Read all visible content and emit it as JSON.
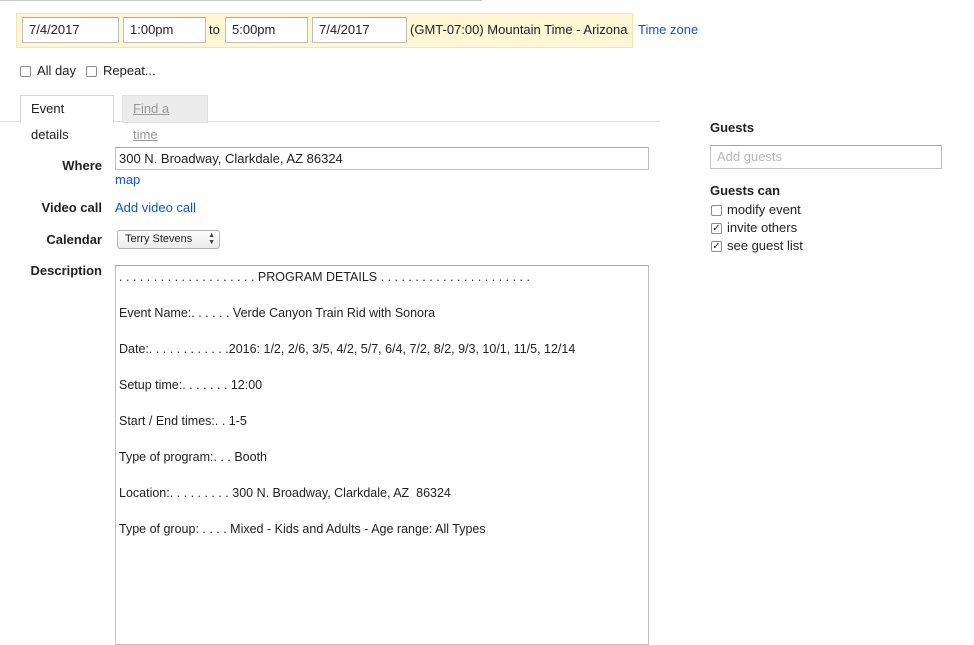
{
  "datetime": {
    "start_date": "7/4/2017",
    "start_time": "1:00pm",
    "to_label": "to",
    "end_time": "5:00pm",
    "end_date": "7/4/2017",
    "timezone": "(GMT-07:00) Mountain Time - Arizona",
    "timezone_link": "Time zone"
  },
  "options": {
    "all_day": {
      "label": "All day",
      "checked": false
    },
    "repeat": {
      "label": "Repeat...",
      "checked": false
    }
  },
  "tabs": [
    {
      "label": "Event details",
      "active": true
    },
    {
      "label": "Find a time",
      "active": false
    }
  ],
  "details": {
    "where_label": "Where",
    "where_value": "300 N. Broadway, Clarkdale, AZ 86324",
    "map_link": "map",
    "video_label": "Video call",
    "video_link": "Add video call",
    "calendar_label": "Calendar",
    "calendar_value": "Terry Stevens",
    "description_label": "Description",
    "description_lines": [
      ". . . . . . . . . . . . . . . . . . . . PROGRAM DETAILS . . . . . . . . . . . . . . . . . . . . . .",
      "",
      "Event Name:. . . . . . Verde Canyon Train Rid with Sonora",
      "",
      "Date:. . . . . . . . . . . .2016: 1/2, 2/6, 3/5, 4/2, 5/7, 6/4, 7/2, 8/2, 9/3, 10/1, 11/5, 12/14",
      "",
      "Setup time:. . . . . . . 12:00",
      "",
      "Start / End times:. . 1-5",
      "",
      "Type of program:. . . Booth",
      "",
      "Location:. . . . . . . . . 300 N. Broadway, Clarkdale, AZ  86324",
      "",
      "Type of group: . . . . Mixed - Kids and Adults - Age range: All Types"
    ]
  },
  "guests": {
    "heading": "Guests",
    "placeholder": "Add guests",
    "guests_can_heading": "Guests can",
    "permissions": [
      {
        "label": "modify event",
        "checked": false
      },
      {
        "label": "invite others",
        "checked": true
      },
      {
        "label": "see guest list",
        "checked": true
      }
    ]
  }
}
